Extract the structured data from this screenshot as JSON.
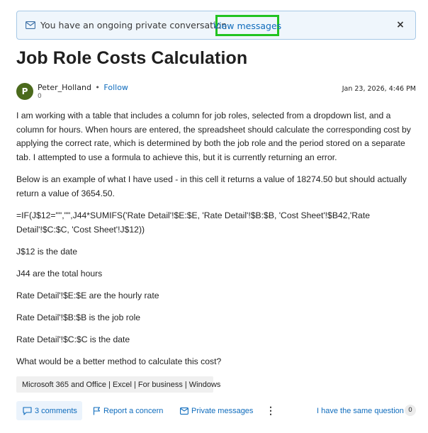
{
  "banner": {
    "text": "You have an ongoing private conversation",
    "link": "View messages",
    "close": "×"
  },
  "post": {
    "title": "Job Role Costs Calculation",
    "author": {
      "initial": "P",
      "name": "Peter_Holland",
      "separator": "•",
      "follow": "Follow",
      "score": "0"
    },
    "date": "Jan 23, 2026, 4:46 PM",
    "paragraphs": [
      "I am working with a table that includes a column for job roles, selected from a dropdown list, and a column for hours. When hours are entered, the spreadsheet should calculate the corresponding cost by applying the correct rate, which is determined by both the job role and the period stored on a separate tab. I attempted to use a formula to achieve this, but it is currently returning an error.",
      "Below is an example of what I have used - in this cell it returns a value of 18274.50 but should actually return a value of 3654.50.",
      "=IF(J$12=\"\",\"\",J44*SUMIFS('Rate Detail'!$E:$E, 'Rate Detail'!$B:$B, 'Cost Sheet'!$B42,'Rate Detail'!$C:$C, 'Cost Sheet'!J$12))",
      "J$12 is the date",
      "J44 are the total hours",
      "Rate Detail'!$E:$E are the hourly rate",
      "Rate Detail'!$B:$B is the job role",
      "Rate Detail'!$C:$C is the date",
      "What would be a better method to calculate this cost?"
    ],
    "tag": "Microsoft 365 and Office | Excel | For business | Windows"
  },
  "actions": {
    "comments": "3 comments",
    "report": "Report a concern",
    "private": "Private messages",
    "more": "⋮",
    "same_question": "I have the same question",
    "same_count": "0"
  },
  "colors": {
    "link": "#0f6cbd",
    "highlight_border": "#22c321",
    "banner_bg": "#eff6fc",
    "avatar_bg": "#4b6a1c"
  }
}
